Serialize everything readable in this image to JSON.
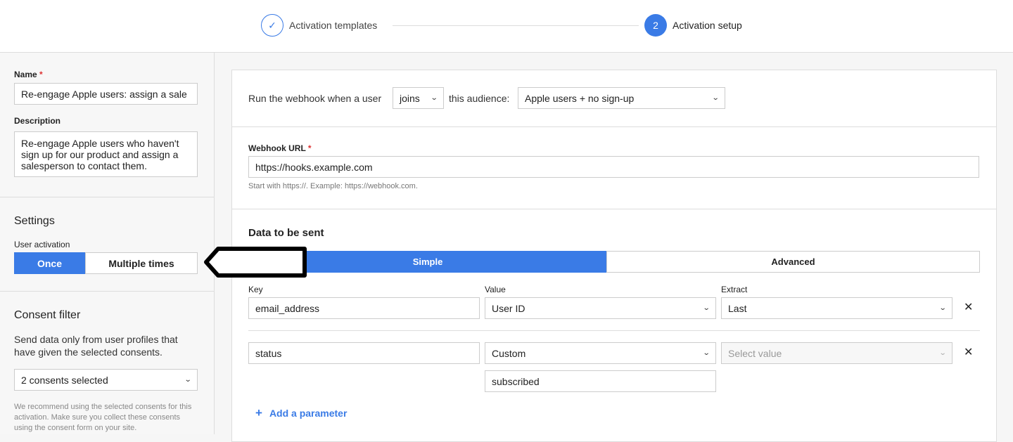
{
  "stepper": {
    "steps": [
      {
        "label": "Activation templates",
        "status": "done",
        "icon": "check-icon"
      },
      {
        "label": "Activation setup",
        "number": "2",
        "status": "current"
      }
    ]
  },
  "sidebar": {
    "name_label": "Name",
    "required_mark": "*",
    "name_value": "Re-engage Apple users: assign a sale",
    "description_label": "Description",
    "description_value": "Re-engage Apple users who haven't sign up for our product and assign a salesperson to contact them.",
    "settings_title": "Settings",
    "user_activation_label": "User activation",
    "activation_options": [
      "Once",
      "Multiple times"
    ],
    "activation_selected": "Once",
    "consent_title": "Consent filter",
    "consent_desc": "Send data only from user profiles that have given the selected consents.",
    "consent_select": "2 consents selected",
    "consent_note": "We recommend using the selected consents for this activation. Make sure you collect these consents using the consent form on your site."
  },
  "main": {
    "trigger": {
      "prefix": "Run the webhook when a user",
      "event": "joins",
      "middle": "this audience:",
      "audience": "Apple users + no sign-up"
    },
    "webhook": {
      "label": "Webhook URL",
      "required_mark": "*",
      "value": "https://hooks.example.com",
      "hint": "Start with https://. Example: https://webhook.com."
    },
    "data": {
      "title": "Data to be sent",
      "tabs": [
        "Simple",
        "Advanced"
      ],
      "active_tab": "Simple",
      "headers": {
        "key": "Key",
        "value": "Value",
        "extract": "Extract"
      },
      "rows": [
        {
          "key": "email_address",
          "value": "User ID",
          "extract": "Last",
          "extract_placeholder": false
        },
        {
          "key": "status",
          "value": "Custom",
          "extract": "Select value",
          "extract_placeholder": true,
          "custom_value": "subscribed"
        }
      ],
      "add_label": "Add a parameter",
      "remove_icon": "✕"
    }
  },
  "colors": {
    "accent": "#3a7be6",
    "annotation": "#000000"
  }
}
